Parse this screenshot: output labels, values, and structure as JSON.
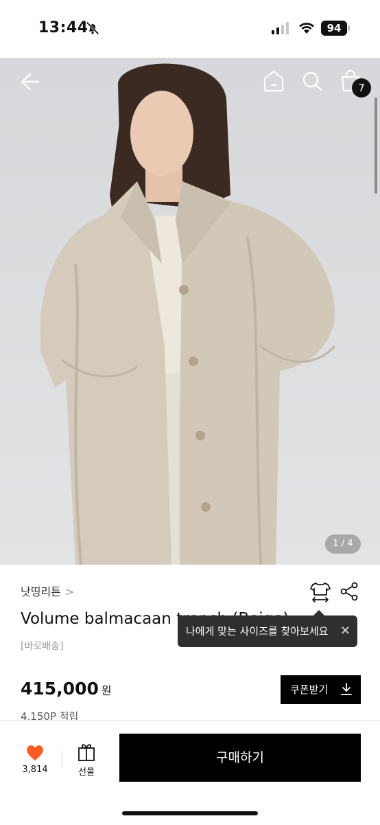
{
  "status_bar": {
    "time": "13:44",
    "battery": "94"
  },
  "header": {
    "cart_count": "7"
  },
  "gallery": {
    "pager": "1 / 4"
  },
  "product": {
    "brand": "낫띵리튼",
    "brand_chevron": ">",
    "title": "Volume balmacaan trench (Beige)",
    "tooltip": "나에게 맞는 사이즈를 찾아보세요",
    "tooltip_close": "✕",
    "delivery": "[바로배송]",
    "price": "415,000",
    "currency": "원",
    "coupon_label": "쿠폰받기",
    "points": "4,150P 적립"
  },
  "bottom_bar": {
    "like_count": "3,814",
    "gift_label": "선물",
    "buy_label": "구매하기"
  },
  "colors": {
    "accent_heart": "#ff5a1f",
    "primary": "#000000"
  }
}
